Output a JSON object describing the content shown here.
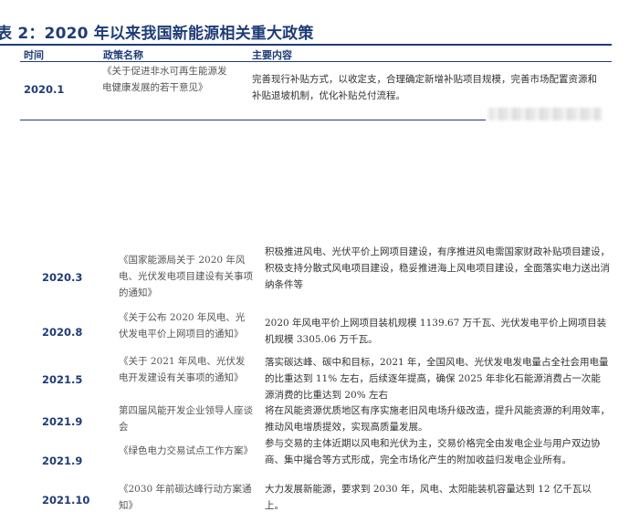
{
  "title": "表 2：2020 年以来我国新能源相关重大政策",
  "headers": {
    "time": "时间",
    "policy": "政策名称",
    "content": "主要内容"
  },
  "rows": [
    {
      "date": "2020.1",
      "name": "《关于促进非水可再生能源发电健康发展的若干意见》",
      "content": "完善现行补贴方式，以收定支，合理确定新增补贴项目规模，完善市场配置资源和补贴退坡机制，优化补贴兑付流程。"
    },
    {
      "date": "2020.3",
      "name": "《国家能源局关于 2020 年风电、光伏发电项目建设有关事项的通知》",
      "content": "积极推进风电、光伏平价上网项目建设，有序推进风电需国家财政补贴项目建设，积极支持分散式风电项目建设，稳妥推进海上风电项目建设，全面落实电力送出消纳条件等"
    },
    {
      "date": "2020.8",
      "name": "《关于公布 2020 年风电、光伏发电平价上网项目的通知》",
      "content": "2020 年风电平价上网项目装机规模 1139.67 万千瓦、光伏发电平价上网项目装机规模 3305.06 万千瓦。"
    },
    {
      "date": "2021.5",
      "name": "《关于 2021 年风电、光伏发电开发建设有关事项的通知》",
      "content": "落实碳达峰、碳中和目标，2021 年，全国风电、光伏发电发电量占全社会用电量的比重达到 11% 左右，后续逐年提高，确保 2025 年非化石能源消费占一次能源消费的比重达到 20% 左右"
    },
    {
      "date": "2021.9",
      "name": "第四届风能开发企业领导人座谈会",
      "content": "将在风能资源优质地区有序实施老旧风电场升级改造，提升风能资源的利用效率，推动风电增质提效，实现高质量发展。"
    },
    {
      "date": "2021.9",
      "name": "《绿色电力交易试点工作方案》",
      "content": "参与交易的主体近期以风电和光伏为主，交易价格完全由发电企业与用户双边协商、集中撮合等方式形成，完全市场化产生的附加收益归发电企业所有。"
    },
    {
      "date": "2021.10",
      "name": "《2030 年前碳达峰行动方案通知》",
      "content": "大力发展新能源，要求到 2030 年，风电、太阳能装机容量达到 12 亿千瓦以上。"
    }
  ]
}
